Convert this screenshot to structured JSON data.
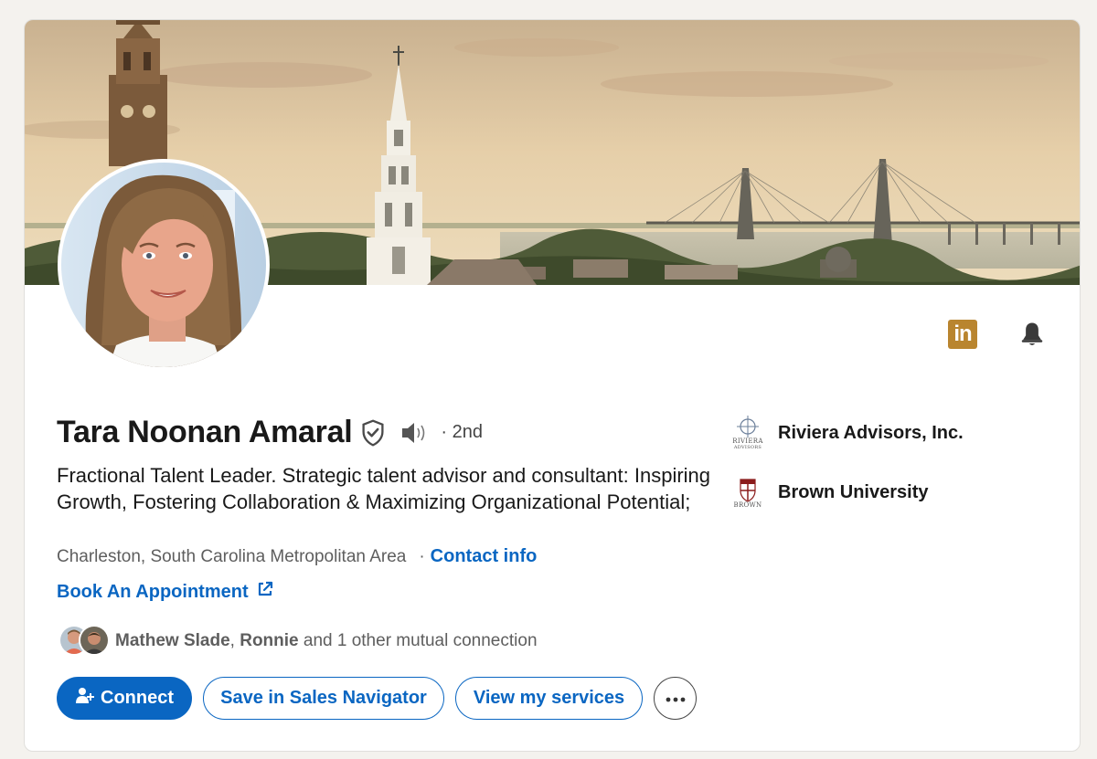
{
  "profile": {
    "name": "Tara Noonan Amaral",
    "degree": "· 2nd",
    "headline": "Fractional Talent Leader. Strategic talent advisor and consultant: Inspiring Growth, Fostering Collaboration & Maximizing Organizational Potential;",
    "location": "Charleston, South Carolina Metropolitan Area",
    "location_separator": "·",
    "contact_info": "Contact info",
    "appointment_link": "Book An Appointment"
  },
  "top_icons": {
    "premium_badge_text": "in"
  },
  "mutual": {
    "name1": "Mathew Slade",
    "comma": ",",
    "name2": "Ronnie",
    "rest": "and 1 other mutual connection"
  },
  "actions": {
    "connect": "Connect",
    "save_sales_navigator": "Save in Sales Navigator",
    "view_services": "View my services"
  },
  "side": {
    "items": [
      {
        "label": "Riviera Advisors, Inc.",
        "logo_text_1": "RIVIERA",
        "logo_text_2": "ADVISORS"
      },
      {
        "label": "Brown University",
        "logo_text_1": "BROWN"
      }
    ]
  },
  "colors": {
    "accent": "#0a66c2",
    "premium_gold": "#b9852f",
    "page_bg": "#f4f2ee"
  }
}
